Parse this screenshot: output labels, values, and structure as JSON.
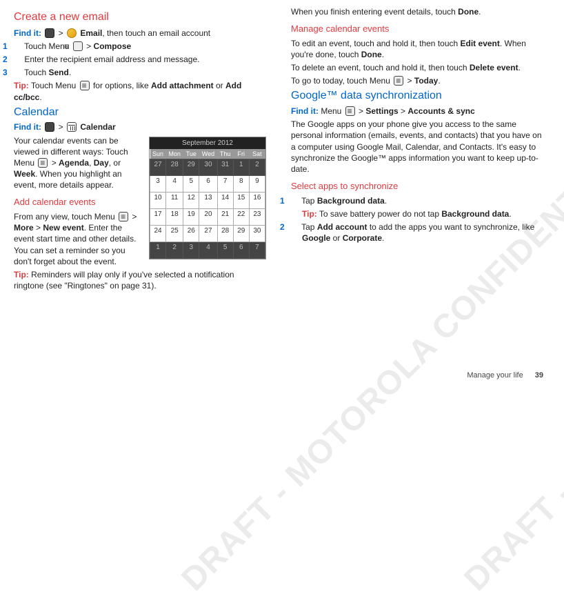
{
  "watermark": "DRAFT - MOTOROLA CONFIDENTIAL & PROPRIETARY INFORMATION",
  "footer": {
    "section": "Manage your life",
    "page": "39"
  },
  "left": {
    "h1": "Create a new email",
    "find_label": "Find it:",
    "find_trail1": " > ",
    "find_email": "Email",
    "find_trail2": ", then touch an email account",
    "s1": "Touch Menu ",
    "s1b": " > ",
    "s1c": "Compose",
    "s2": "Enter the recipient email address and message.",
    "s3a": "Touch ",
    "s3b": "Send",
    "s3c": ".",
    "tip_label": "Tip:",
    "tip1a": " Touch Menu ",
    "tip1b": " for options, like ",
    "tip1c": "Add attachment",
    "tip1d": " or ",
    "tip1e": "Add cc/bcc",
    "tip1f": ".",
    "h2": "Calendar",
    "find2_trail": " > ",
    "find2_cal": "Calendar",
    "p_cal_a": "Your calendar events can be viewed in different ways: Touch Menu ",
    "p_cal_b": " > ",
    "p_cal_c": "Agenda",
    "p_cal_d": ", ",
    "p_cal_e": "Day",
    "p_cal_f": ", or ",
    "p_cal_g": "Week",
    "p_cal_h": ". When you highlight an event, more details appear.",
    "h3": "Add calendar events",
    "add_a": "From any view, touch Menu ",
    "add_b": " > ",
    "add_c": "More",
    "add_d": " > ",
    "add_e": "New event",
    "add_f": ". Enter the event start time and other details. You can set a reminder so you don't forget about the event.",
    "tip2": " Reminders will play only if you've selected a notification ringtone (see \"Ringtones\" on page 31).",
    "calendar": {
      "title": "September 2012",
      "days": [
        "Sun",
        "Mon",
        "Tue",
        "Wed",
        "Thu",
        "Fri",
        "Sat"
      ],
      "rows": [
        [
          "27",
          "28",
          "29",
          "30",
          "31",
          "1",
          "2"
        ],
        [
          "3",
          "4",
          "5",
          "6",
          "7",
          "8",
          "9"
        ],
        [
          "10",
          "11",
          "12",
          "13",
          "14",
          "15",
          "16"
        ],
        [
          "17",
          "18",
          "19",
          "20",
          "21",
          "22",
          "23"
        ],
        [
          "24",
          "25",
          "26",
          "27",
          "28",
          "29",
          "30"
        ],
        [
          "1",
          "2",
          "3",
          "4",
          "5",
          "6",
          "7"
        ]
      ]
    }
  },
  "right": {
    "p1a": "When you finish entering event details, touch ",
    "p1b": "Done",
    "p1c": ".",
    "h1": "Manage calendar events",
    "p2a": "To edit an event, touch and hold it, then touch ",
    "p2b": "Edit event",
    "p2c": ". When you're done, touch ",
    "p2d": "Done",
    "p2e": ".",
    "p3a": "To delete an event, touch and hold it, then touch ",
    "p3b": "Delete event",
    "p3c": ".",
    "p4a": "To go to today, touch Menu ",
    "p4b": " > ",
    "p4c": "Today",
    "p4d": ".",
    "h2": "Google™ data synchronization",
    "find_label": "Find it:",
    "find_a": " Menu ",
    "find_b": " > ",
    "find_c": "Settings",
    "find_d": " > ",
    "find_e": "Accounts & sync",
    "p5": "The Google apps on your phone give you access to the same personal information (emails, events, and contacts) that you have on a computer using Google Mail, Calendar, and Contacts. It's easy to synchronize the Google™ apps information you want to keep up-to-date.",
    "h3": "Select apps to synchronize",
    "s1a": "Tap ",
    "s1b": "Background data",
    "s1c": ".",
    "tip_label": "Tip:",
    "tip1a": " To save battery power do not tap ",
    "tip1b": "Background data",
    "tip1c": ".",
    "s2a": "Tap ",
    "s2b": "Add account",
    "s2c": " to add the apps you want to synchronize, like ",
    "s2d": "Google",
    "s2e": " or ",
    "s2f": "Corporate",
    "s2g": "."
  }
}
